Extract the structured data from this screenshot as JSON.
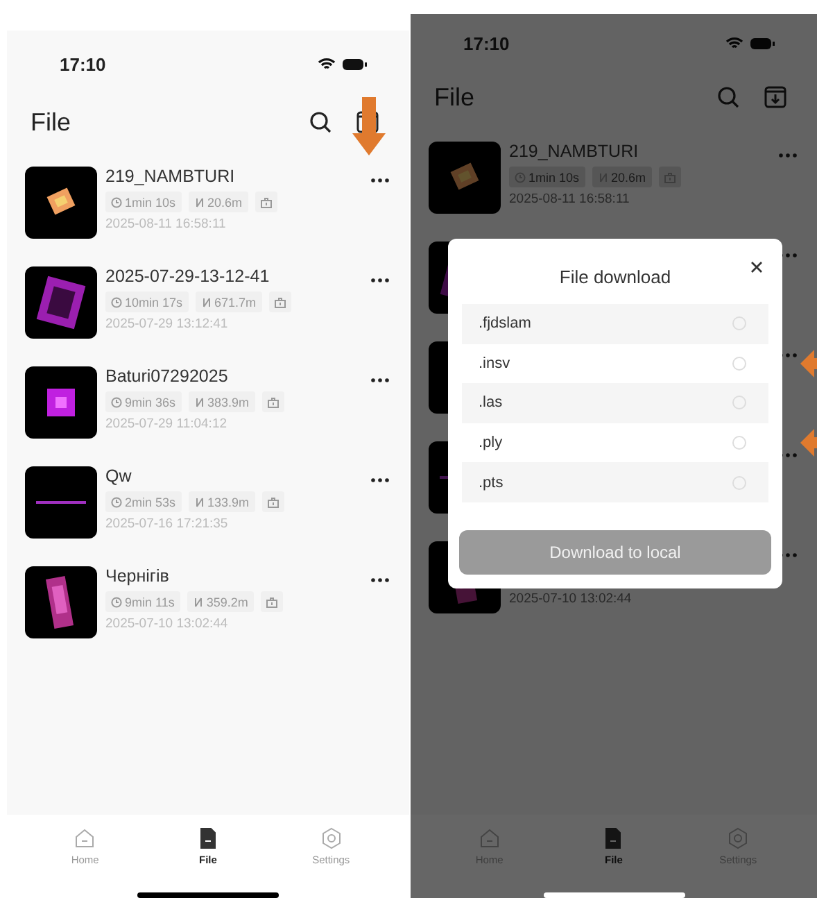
{
  "screens": [
    {
      "status_time": "17:10",
      "title": "File",
      "download_marked": true,
      "files": [
        {
          "name": "219_NAMBTURI",
          "duration": "1min 10s",
          "distance": "20.6m",
          "date": "2025-08-11 16:58:11"
        },
        {
          "name": "2025-07-29-13-12-41",
          "duration": "10min 17s",
          "distance": "671.7m",
          "date": "2025-07-29 13:12:41"
        },
        {
          "name": "Baturi07292025",
          "duration": "9min 36s",
          "distance": "383.9m",
          "date": "2025-07-29 11:04:12"
        },
        {
          "name": "Qw",
          "duration": "2min 53s",
          "distance": "133.9m",
          "date": "2025-07-16 17:21:35"
        },
        {
          "name": "Чернігів",
          "duration": "9min 11s",
          "distance": "359.2m",
          "date": "2025-07-10 13:02:44"
        }
      ],
      "tabs": [
        {
          "kind": "home",
          "label": "Home",
          "selected": false
        },
        {
          "kind": "file",
          "label": "File",
          "selected": true
        },
        {
          "kind": "settings",
          "label": "Settings",
          "selected": false
        }
      ]
    },
    {
      "status_time": "17:10",
      "title": "File",
      "download_marked": false,
      "files": [
        {
          "kind": "full",
          "name": "219_NAMBTURI",
          "duration": "1min 10s",
          "distance": "20.6m",
          "date": "2025-08-11 16:58:11"
        },
        {
          "kind": "covered"
        },
        {
          "kind": "covered"
        },
        {
          "kind": "covered"
        },
        {
          "kind": "covered",
          "date": "2025-07-10 13:02:44"
        }
      ],
      "tabs": [
        {
          "kind": "home",
          "label": "Home",
          "selected": false
        },
        {
          "kind": "file",
          "label": "File",
          "selected": true
        },
        {
          "kind": "settings",
          "label": "Settings",
          "selected": false
        }
      ],
      "dialog": {
        "title": "File download",
        "options": [
          {
            "label": ".fjdslam",
            "selected": false,
            "marked": false
          },
          {
            "label": ".insv",
            "selected": false,
            "marked": true
          },
          {
            "label": ".las",
            "selected": false,
            "marked": false
          },
          {
            "label": ".ply",
            "selected": false,
            "marked": true
          },
          {
            "label": ".pts",
            "selected": false,
            "marked": false
          }
        ],
        "button": {
          "label": "Download to local",
          "disabled": true
        }
      }
    }
  ]
}
